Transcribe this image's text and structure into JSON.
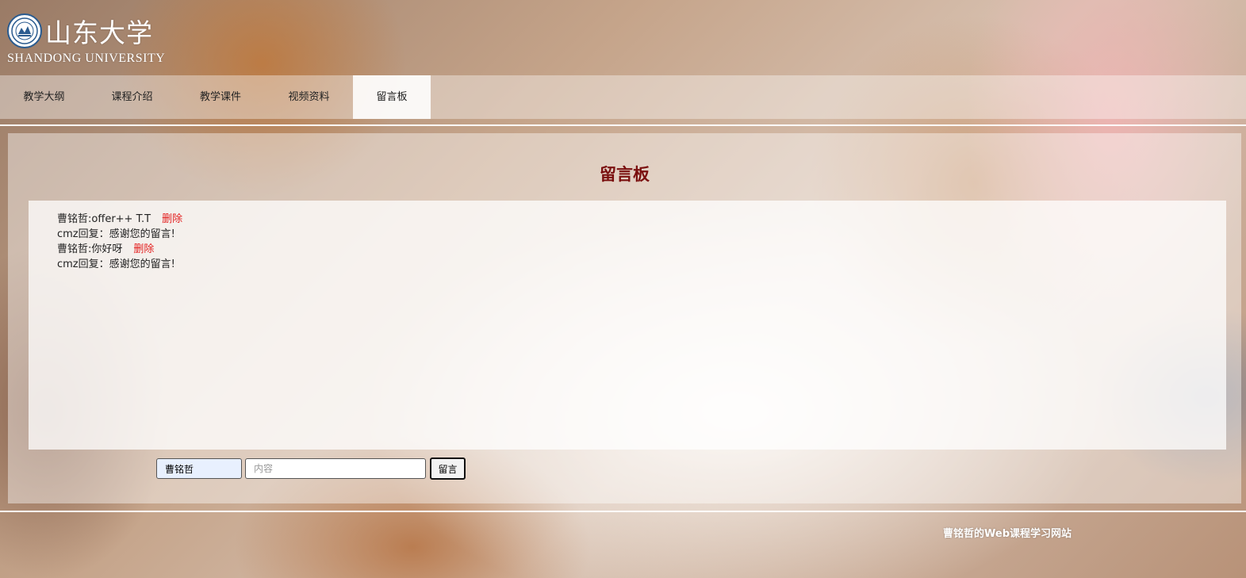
{
  "header": {
    "logo_cn": "山东大学",
    "logo_en": "SHANDONG UNIVERSITY",
    "emblem_icon": "university-emblem-icon"
  },
  "nav": {
    "items": [
      {
        "label": "教学大纲",
        "active": false
      },
      {
        "label": "课程介绍",
        "active": false
      },
      {
        "label": "教学课件",
        "active": false
      },
      {
        "label": "视频资料",
        "active": false
      },
      {
        "label": "留言板",
        "active": true
      }
    ]
  },
  "board": {
    "title": "留言板",
    "messages": [
      {
        "author": "曹铭哲",
        "text": "offer++ T.T",
        "delete_label": "删除"
      },
      {
        "reply": "cmz回复：感谢您的留言!"
      },
      {
        "author": "曹铭哲",
        "text": "你好呀",
        "delete_label": "删除"
      },
      {
        "reply": "cmz回复：感谢您的留言!"
      }
    ]
  },
  "form": {
    "name_value": "曹铭哲",
    "content_placeholder": "内容",
    "content_value": "",
    "submit_label": "留言"
  },
  "footer": {
    "text": "曹铭哲的Web课程学习网站"
  },
  "colors": {
    "title": "#7a0f0f",
    "delete_link": "#e32020",
    "emblem_ring": "#2a5b8f"
  }
}
